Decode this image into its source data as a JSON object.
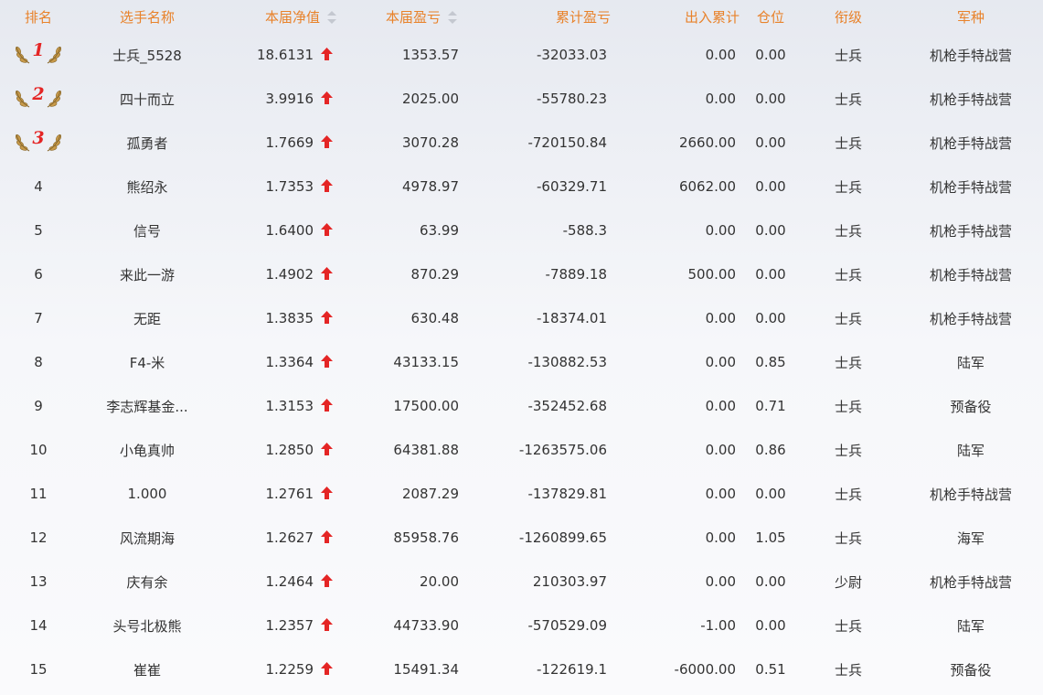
{
  "headers": {
    "rank": "排名",
    "name": "选手名称",
    "nav": "本届净值",
    "pnl": "本届盈亏",
    "cum": "累计盈亏",
    "io": "出入累计",
    "pos": "仓位",
    "level": "衔级",
    "arm": "军种"
  },
  "colors": {
    "header_text": "#e8822a",
    "up_arrow": "#e42525",
    "medal_number": "#e42525"
  },
  "rows": [
    {
      "rank": "1",
      "medal": true,
      "name": "士兵_5528",
      "nav": "18.6131",
      "trend": "up-arrow-icon",
      "pnl": "1353.57",
      "cum": "-32033.03",
      "io": "0.00",
      "pos": "0.00",
      "level": "士兵",
      "arm": "机枪手特战营"
    },
    {
      "rank": "2",
      "medal": true,
      "name": "四十而立",
      "nav": "3.9916",
      "trend": "up-arrow-icon",
      "pnl": "2025.00",
      "cum": "-55780.23",
      "io": "0.00",
      "pos": "0.00",
      "level": "士兵",
      "arm": "机枪手特战营"
    },
    {
      "rank": "3",
      "medal": true,
      "name": "孤勇者",
      "nav": "1.7669",
      "trend": "up-arrow-icon",
      "pnl": "3070.28",
      "cum": "-720150.84",
      "io": "2660.00",
      "pos": "0.00",
      "level": "士兵",
      "arm": "机枪手特战营"
    },
    {
      "rank": "4",
      "medal": false,
      "name": "熊绍永",
      "nav": "1.7353",
      "trend": "up-arrow-icon",
      "pnl": "4978.97",
      "cum": "-60329.71",
      "io": "6062.00",
      "pos": "0.00",
      "level": "士兵",
      "arm": "机枪手特战营"
    },
    {
      "rank": "5",
      "medal": false,
      "name": "信号",
      "nav": "1.6400",
      "trend": "up-arrow-icon",
      "pnl": "63.99",
      "cum": "-588.3",
      "io": "0.00",
      "pos": "0.00",
      "level": "士兵",
      "arm": "机枪手特战营"
    },
    {
      "rank": "6",
      "medal": false,
      "name": "来此一游",
      "nav": "1.4902",
      "trend": "up-arrow-icon",
      "pnl": "870.29",
      "cum": "-7889.18",
      "io": "500.00",
      "pos": "0.00",
      "level": "士兵",
      "arm": "机枪手特战营"
    },
    {
      "rank": "7",
      "medal": false,
      "name": "无距",
      "nav": "1.3835",
      "trend": "up-arrow-icon",
      "pnl": "630.48",
      "cum": "-18374.01",
      "io": "0.00",
      "pos": "0.00",
      "level": "士兵",
      "arm": "机枪手特战营"
    },
    {
      "rank": "8",
      "medal": false,
      "name": "F4-米",
      "nav": "1.3364",
      "trend": "up-arrow-icon",
      "pnl": "43133.15",
      "cum": "-130882.53",
      "io": "0.00",
      "pos": "0.85",
      "level": "士兵",
      "arm": "陆军"
    },
    {
      "rank": "9",
      "medal": false,
      "name": "李志辉基金...",
      "nav": "1.3153",
      "trend": "up-arrow-icon",
      "pnl": "17500.00",
      "cum": "-352452.68",
      "io": "0.00",
      "pos": "0.71",
      "level": "士兵",
      "arm": "预备役"
    },
    {
      "rank": "10",
      "medal": false,
      "name": "小龟真帅",
      "nav": "1.2850",
      "trend": "up-arrow-icon",
      "pnl": "64381.88",
      "cum": "-1263575.06",
      "io": "0.00",
      "pos": "0.86",
      "level": "士兵",
      "arm": "陆军"
    },
    {
      "rank": "11",
      "medal": false,
      "name": "1.000",
      "nav": "1.2761",
      "trend": "up-arrow-icon",
      "pnl": "2087.29",
      "cum": "-137829.81",
      "io": "0.00",
      "pos": "0.00",
      "level": "士兵",
      "arm": "机枪手特战营"
    },
    {
      "rank": "12",
      "medal": false,
      "name": "风流期海",
      "nav": "1.2627",
      "trend": "up-arrow-icon",
      "pnl": "85958.76",
      "cum": "-1260899.65",
      "io": "0.00",
      "pos": "1.05",
      "level": "士兵",
      "arm": "海军"
    },
    {
      "rank": "13",
      "medal": false,
      "name": "庆有余",
      "nav": "1.2464",
      "trend": "up-arrow-icon",
      "pnl": "20.00",
      "cum": "210303.97",
      "io": "0.00",
      "pos": "0.00",
      "level": "少尉",
      "arm": "机枪手特战营"
    },
    {
      "rank": "14",
      "medal": false,
      "name": "头号北极熊",
      "nav": "1.2357",
      "trend": "up-arrow-icon",
      "pnl": "44733.90",
      "cum": "-570529.09",
      "io": "-1.00",
      "pos": "0.00",
      "level": "士兵",
      "arm": "陆军"
    },
    {
      "rank": "15",
      "medal": false,
      "name": "崔崔",
      "nav": "1.2259",
      "trend": "up-arrow-icon",
      "pnl": "15491.34",
      "cum": "-122619.1",
      "io": "-6000.00",
      "pos": "0.51",
      "level": "士兵",
      "arm": "预备役"
    }
  ]
}
